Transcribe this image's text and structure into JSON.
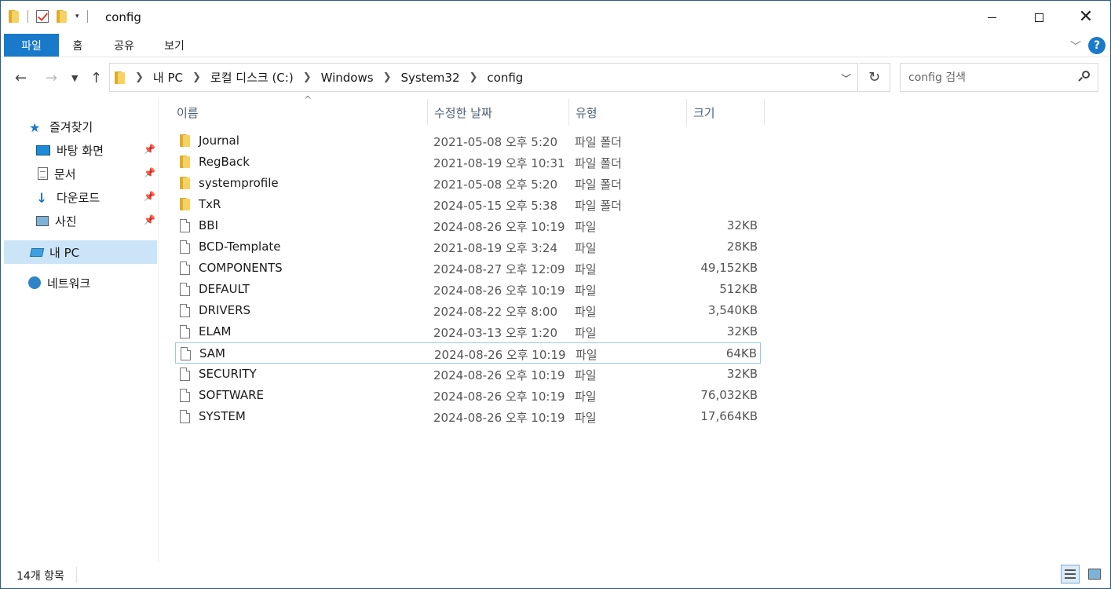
{
  "window": {
    "title": "config",
    "qat_dropdown": "▾"
  },
  "ribbon": {
    "tabs": [
      "파일",
      "홈",
      "공유",
      "보기"
    ],
    "help": "?"
  },
  "address": {
    "crumbs": [
      "내 PC",
      "로컬 디스크 (C:)",
      "Windows",
      "System32",
      "config"
    ]
  },
  "search": {
    "placeholder": "config 검색"
  },
  "navpane": {
    "quick_access": "즐겨찾기",
    "pinned": [
      "바탕 화면",
      "문서",
      "다운로드",
      "사진"
    ],
    "this_pc": "내 PC",
    "network": "네트워크"
  },
  "columns": {
    "name": "이름",
    "date": "수정한 날짜",
    "type": "유형",
    "size": "크기"
  },
  "files": [
    {
      "name": "Journal",
      "date": "2021-05-08 오후 5:20",
      "type": "파일 폴더",
      "size": "",
      "kind": "folder"
    },
    {
      "name": "RegBack",
      "date": "2021-08-19 오후 10:31",
      "type": "파일 폴더",
      "size": "",
      "kind": "folder"
    },
    {
      "name": "systemprofile",
      "date": "2021-05-08 오후 5:20",
      "type": "파일 폴더",
      "size": "",
      "kind": "folder"
    },
    {
      "name": "TxR",
      "date": "2024-05-15 오후 5:38",
      "type": "파일 폴더",
      "size": "",
      "kind": "folder"
    },
    {
      "name": "BBI",
      "date": "2024-08-26 오후 10:19",
      "type": "파일",
      "size": "32KB",
      "kind": "file"
    },
    {
      "name": "BCD-Template",
      "date": "2021-08-19 오후 3:24",
      "type": "파일",
      "size": "28KB",
      "kind": "file"
    },
    {
      "name": "COMPONENTS",
      "date": "2024-08-27 오후 12:09",
      "type": "파일",
      "size": "49,152KB",
      "kind": "file"
    },
    {
      "name": "DEFAULT",
      "date": "2024-08-26 오후 10:19",
      "type": "파일",
      "size": "512KB",
      "kind": "file"
    },
    {
      "name": "DRIVERS",
      "date": "2024-08-22 오후 8:00",
      "type": "파일",
      "size": "3,540KB",
      "kind": "file"
    },
    {
      "name": "ELAM",
      "date": "2024-03-13 오후 1:20",
      "type": "파일",
      "size": "32KB",
      "kind": "file"
    },
    {
      "name": "SAM",
      "date": "2024-08-26 오후 10:19",
      "type": "파일",
      "size": "64KB",
      "kind": "file",
      "focused": true
    },
    {
      "name": "SECURITY",
      "date": "2024-08-26 오후 10:19",
      "type": "파일",
      "size": "32KB",
      "kind": "file"
    },
    {
      "name": "SOFTWARE",
      "date": "2024-08-26 오후 10:19",
      "type": "파일",
      "size": "76,032KB",
      "kind": "file"
    },
    {
      "name": "SYSTEM",
      "date": "2024-08-26 오후 10:19",
      "type": "파일",
      "size": "17,664KB",
      "kind": "file"
    }
  ],
  "status": {
    "item_count": "14개 항목"
  },
  "colors": {
    "accent": "#1979ca",
    "selection": "#cce4f7",
    "focus_border": "#99c9ef",
    "folder": "#f8d163"
  },
  "icons": {
    "back": "arrow-left-icon",
    "forward": "arrow-right-icon",
    "up": "arrow-up-icon",
    "refresh": "refresh-icon",
    "search": "search-icon"
  }
}
